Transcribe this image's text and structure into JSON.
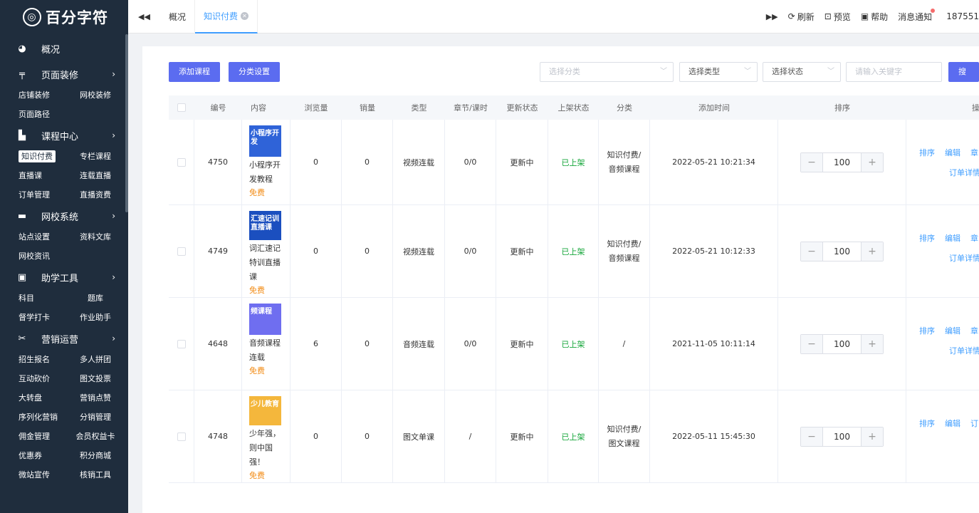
{
  "logo": {
    "text": "百分字符"
  },
  "sidebar": {
    "overview": "概况",
    "sections": [
      {
        "title": "页面装修",
        "icon": "layout-icon",
        "items": [
          "店铺装修",
          "网校装修",
          "页面路径"
        ]
      },
      {
        "title": "课程中心",
        "icon": "book-icon",
        "items": [
          "知识付费",
          "专栏课程",
          "直播课",
          "连载直播",
          "订单管理",
          "直播资费"
        ]
      },
      {
        "title": "网校系统",
        "icon": "monitor-icon",
        "items": [
          "站点设置",
          "资料文库",
          "网校资讯"
        ]
      },
      {
        "title": "助学工具",
        "icon": "briefcase-icon",
        "items": [
          "科目",
          "题库",
          "督学打卡",
          "作业助手"
        ]
      },
      {
        "title": "营销运营",
        "icon": "megaphone-icon",
        "items": [
          "招生报名",
          "多人拼团",
          "互动砍价",
          "图文投票",
          "大转盘",
          "营销点赞",
          "序列化营销",
          "分销管理",
          "佣金管理",
          "会员权益卡",
          "优惠券",
          "积分商城",
          "微站宣传",
          "核销工具"
        ]
      }
    ],
    "active_item": "知识付费"
  },
  "header": {
    "tabs": [
      {
        "label": "概况"
      },
      {
        "label": "知识付费"
      }
    ],
    "actions": {
      "refresh": "刷新",
      "preview": "预览",
      "help": "帮助",
      "notify": "消息通知",
      "user": "187551"
    }
  },
  "toolbar": {
    "add_course": "添加课程",
    "category_settings": "分类设置",
    "select_category": "选择分类",
    "select_type": "选择类型",
    "select_status": "选择状态",
    "keyword_placeholder": "请输入关键字",
    "search": "搜索"
  },
  "table": {
    "headers": [
      "编号",
      "内容",
      "浏览量",
      "销量",
      "类型",
      "章节/课时",
      "更新状态",
      "上架状态",
      "分类",
      "添加时间",
      "排序",
      "操作"
    ],
    "rows": [
      {
        "id": "4750",
        "title": "小程序开发教程",
        "price": "免费",
        "views": "0",
        "sales": "0",
        "type": "视频连载",
        "chapters": "0/0",
        "update": "更新中",
        "listing": "已上架",
        "category": "知识付费/音频课程",
        "time": "2022-05-21 10:21:34",
        "sort": "100",
        "ops": [
          "排序",
          "编辑",
          "章"
        ],
        "ops2": "订单详情",
        "thumb_text": "小程序开发",
        "thumb_color": "#2f63d8"
      },
      {
        "id": "4749",
        "title": "词汇速记特训直播课",
        "price": "免费",
        "views": "0",
        "sales": "0",
        "type": "视频连载",
        "chapters": "0/0",
        "update": "更新中",
        "listing": "已上架",
        "category": "知识付费/音频课程",
        "time": "2022-05-21 10:12:33",
        "sort": "100",
        "ops": [
          "排序",
          "编辑",
          "章"
        ],
        "ops2": "订单详情",
        "thumb_text": "汇速记训直播课",
        "thumb_color": "#1b4fbf"
      },
      {
        "id": "4648",
        "title": "音频课程连载",
        "price": "免费",
        "views": "6",
        "sales": "0",
        "type": "音频连载",
        "chapters": "0/0",
        "update": "更新中",
        "listing": "已上架",
        "category": "/",
        "time": "2021-11-05 10:11:14",
        "sort": "100",
        "ops": [
          "排序",
          "编辑",
          "章"
        ],
        "ops2": "订单详情",
        "thumb_text": "频课程",
        "thumb_color": "#6f6ef0"
      },
      {
        "id": "4748",
        "title": "少年强，则中国强！",
        "price": "免费",
        "views": "0",
        "sales": "0",
        "type": "图文单课",
        "chapters": "/",
        "update": "更新中",
        "listing": "已上架",
        "category": "知识付费/图文课程",
        "time": "2022-05-11 15:45:30",
        "sort": "100",
        "ops": [
          "排序",
          "编辑",
          "订"
        ],
        "ops2": "",
        "thumb_text": "少儿教育",
        "thumb_color": "#f4b73c"
      }
    ]
  }
}
